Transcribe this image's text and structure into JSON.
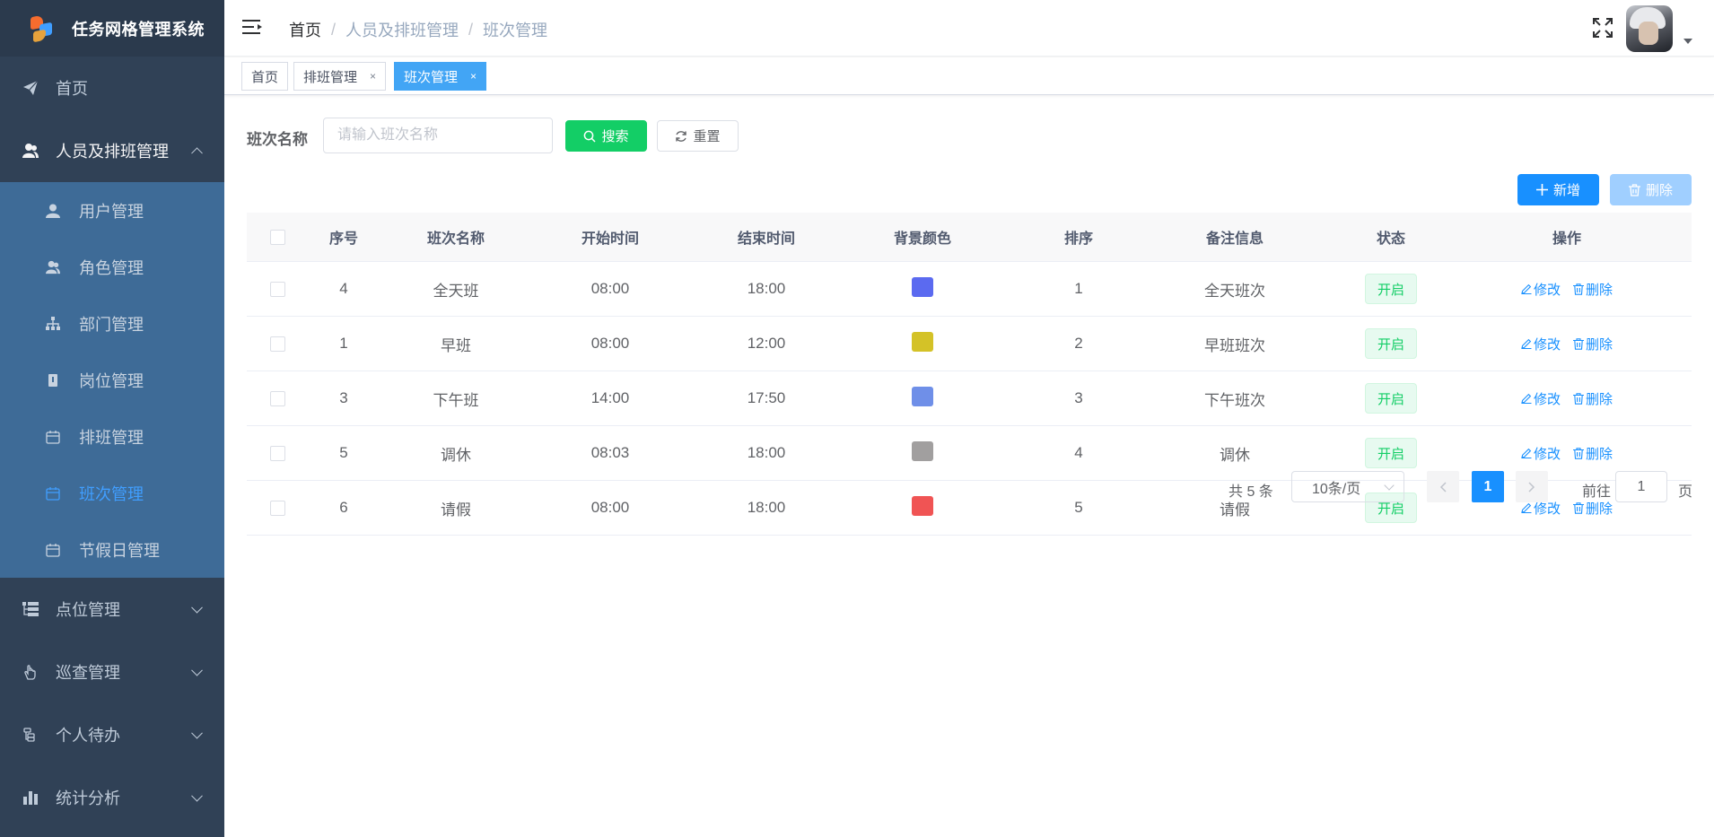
{
  "app": {
    "title": "任务网格管理系统"
  },
  "sidebar": {
    "items": [
      {
        "label": "首页",
        "icon": "paper-plane-icon"
      },
      {
        "label": "人员及排班管理",
        "icon": "people-icon",
        "expanded": true,
        "children": [
          {
            "label": "用户管理",
            "icon": "user-icon"
          },
          {
            "label": "角色管理",
            "icon": "peoples-icon"
          },
          {
            "label": "部门管理",
            "icon": "tree-icon"
          },
          {
            "label": "岗位管理",
            "icon": "post-icon"
          },
          {
            "label": "排班管理",
            "icon": "date-icon"
          },
          {
            "label": "班次管理",
            "icon": "date-icon",
            "active": true
          },
          {
            "label": "节假日管理",
            "icon": "date-icon"
          }
        ]
      },
      {
        "label": "点位管理",
        "icon": "tree-table-icon"
      },
      {
        "label": "巡查管理",
        "icon": "hand-icon"
      },
      {
        "label": "个人待办",
        "icon": "todo-icon"
      },
      {
        "label": "统计分析",
        "icon": "bar-chart-icon"
      }
    ]
  },
  "header": {
    "breadcrumb": [
      "首页",
      "人员及排班管理",
      "班次管理"
    ],
    "separator": "/"
  },
  "tags": [
    {
      "label": "首页",
      "closable": false,
      "active": false
    },
    {
      "label": "排班管理",
      "closable": true,
      "active": false
    },
    {
      "label": "班次管理",
      "closable": true,
      "active": true
    }
  ],
  "tag_close": "×",
  "search": {
    "label": "班次名称",
    "placeholder": "请输入班次名称",
    "value": "",
    "search_button": "搜索",
    "reset_button": "重置"
  },
  "toolbar": {
    "add_button": "新增",
    "delete_button": "删除"
  },
  "table": {
    "columns": [
      "序号",
      "班次名称",
      "开始时间",
      "结束时间",
      "背景颜色",
      "排序",
      "备注信息",
      "状态",
      "操作"
    ],
    "rows": [
      {
        "id": "4",
        "name": "全天班",
        "start": "08:00",
        "end": "18:00",
        "color": "#5b6af0",
        "sort": "1",
        "remark": "全天班次",
        "status": "开启"
      },
      {
        "id": "1",
        "name": "早班",
        "start": "08:00",
        "end": "12:00",
        "color": "#d4c227",
        "sort": "2",
        "remark": "早班班次",
        "status": "开启"
      },
      {
        "id": "3",
        "name": "下午班",
        "start": "14:00",
        "end": "17:50",
        "color": "#6f8fe8",
        "sort": "3",
        "remark": "下午班次",
        "status": "开启"
      },
      {
        "id": "5",
        "name": "调休",
        "start": "08:03",
        "end": "18:00",
        "color": "#a19f9f",
        "sort": "4",
        "remark": "调休",
        "status": "开启"
      },
      {
        "id": "6",
        "name": "请假",
        "start": "08:00",
        "end": "18:00",
        "color": "#f05454",
        "sort": "5",
        "remark": "请假",
        "status": "开启"
      }
    ],
    "edit_label": "修改",
    "delete_label": "删除"
  },
  "pagination": {
    "total_text": "共 5 条",
    "page_size": "10条/页",
    "current_page": "1",
    "goto_label": "前往",
    "goto_value": "1",
    "page_unit": "页"
  },
  "colors": {
    "sidebar_bg": "#304156",
    "submenu_bg": "#3e6b97",
    "accent": "#1890ff",
    "success": "#13ce66",
    "active_tag": "#42a5f5"
  }
}
